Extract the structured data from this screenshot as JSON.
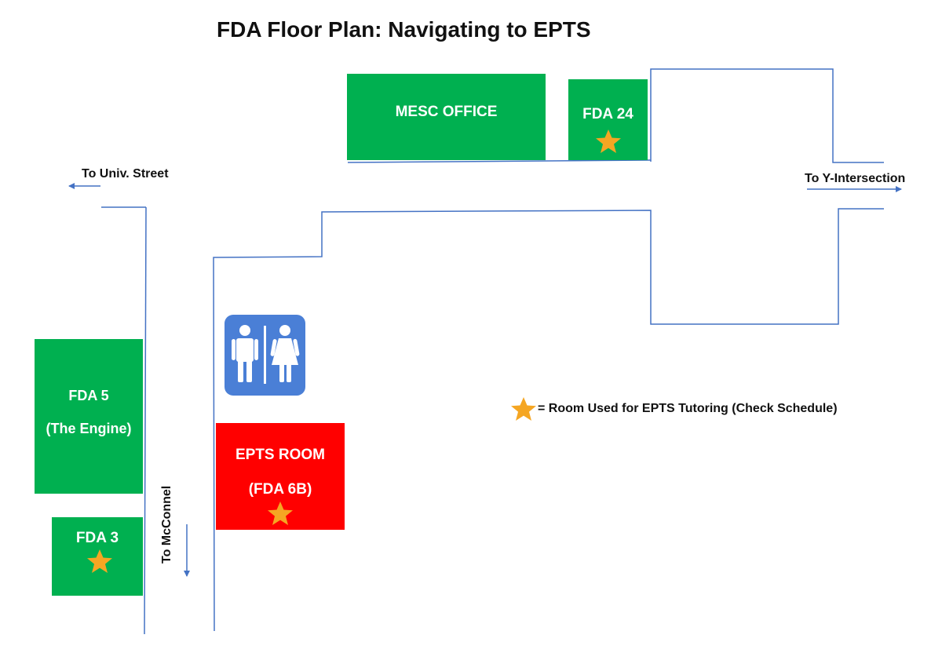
{
  "title": "FDA Floor Plan: Navigating to EPTS",
  "colors": {
    "room_green": "#00b050",
    "epts_red": "#ff0000",
    "wall_blue": "#4472c4",
    "restroom_blue": "#4a7fd6",
    "star_gold": "#f5a623"
  },
  "rooms": {
    "mesc_office": {
      "label": "MESC OFFICE"
    },
    "fda24": {
      "label": "FDA 24",
      "tutoring": true
    },
    "fda5": {
      "label": "FDA 5",
      "sublabel": "(The Engine)"
    },
    "fda3": {
      "label": "FDA 3",
      "tutoring": true
    },
    "epts_room": {
      "label": "EPTS ROOM",
      "sublabel": "(FDA 6B)",
      "tutoring": true
    }
  },
  "directions": {
    "univ_street": "To Univ. Street",
    "y_intersection": "To Y-Intersection",
    "mcconnel": "To McConnel"
  },
  "restroom": {
    "icon": "restroom-icon"
  },
  "legend": {
    "icon": "star-icon",
    "text": "= Room Used for EPTS Tutoring (Check Schedule)"
  }
}
